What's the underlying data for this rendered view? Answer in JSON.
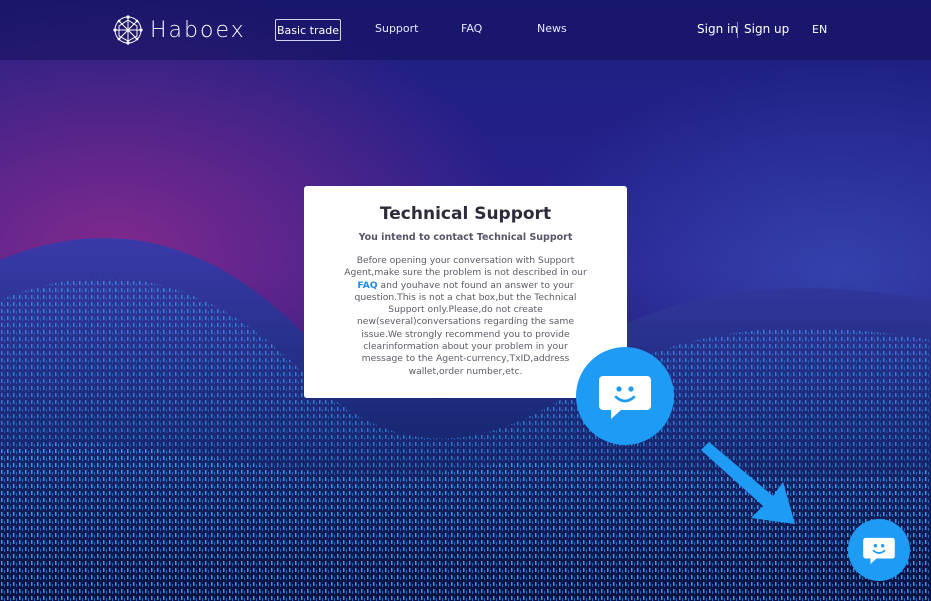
{
  "header": {
    "logo_text": "Haboex",
    "nav": {
      "basic_trade": "Basic trade",
      "support": "Support",
      "faq": "FAQ",
      "news": "News"
    },
    "sign_in": "Sign in",
    "sign_up": "Sign up",
    "language": "EN"
  },
  "dialog": {
    "title": "Technical Support",
    "subtitle": "You intend to contact Technical Support",
    "body_before_link": "Before opening your conversation with Support Agent,make sure the problem is not described in our ",
    "link_text": "FAQ",
    "body_after_link": " and youhave not found an answer to your question.This is not a chat box,but the Technical Support only.Please,do not create new(several)conversations regarding the same issue.We strongly recommend you to provide clearinformation about your problem in your message to the Agent-currency,TxID,address wallet,order number,etc."
  },
  "icons": {
    "logo": "network-globe-icon",
    "chat_big": "chat-smile-icon",
    "chat_small": "chat-smile-icon",
    "arrow": "arrow-down-right-icon"
  },
  "colors": {
    "accent": "#1e9bf5",
    "link": "#1a8cf0",
    "background_top": "#22238a",
    "background_mid": "#5a1f8c"
  }
}
